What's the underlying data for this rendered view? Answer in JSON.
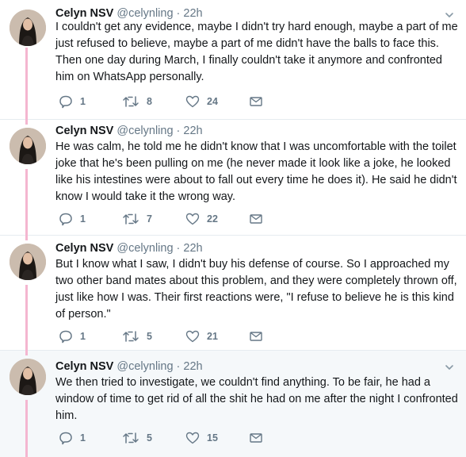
{
  "tweets": [
    {
      "name": "Celyn NSV",
      "handle": "@celynling",
      "separator": "·",
      "time": "22h",
      "text": "I couldn't get any evidence, maybe I didn't try hard enough, maybe a part of me just refused to believe, maybe a part of me didn't have the balls to face this. Then one day during March, I finally couldn't take it anymore and confronted him on WhatsApp personally.",
      "replies": "1",
      "retweets": "8",
      "likes": "24"
    },
    {
      "name": "Celyn NSV",
      "handle": "@celynling",
      "separator": "·",
      "time": "22h",
      "text": "He was calm, he told me he didn't know that I was uncomfortable with the toilet joke that he's been pulling on me (he never made it look like a joke, he looked like his intestines were about to fall out every time he does it). He said he didn't know I would take it the wrong way.",
      "replies": "1",
      "retweets": "7",
      "likes": "22"
    },
    {
      "name": "Celyn NSV",
      "handle": "@celynling",
      "separator": "·",
      "time": "22h",
      "text": "But I know what I saw, I didn't buy his defense of course. So I approached my two other band mates about this problem, and they were completely thrown off, just like how I was. Their first reactions were, \"I refuse to believe he is this kind of person.\"",
      "replies": "1",
      "retweets": "5",
      "likes": "21"
    },
    {
      "name": "Celyn NSV",
      "handle": "@celynling",
      "separator": "·",
      "time": "22h",
      "text": "We then tried to investigate, we couldn't find anything. To be fair, he had a window of time to get rid of all the shit he had on me after the night I confronted him.",
      "replies": "1",
      "retweets": "5",
      "likes": "15"
    }
  ],
  "colors": {
    "thread_line": "#f4b6d0",
    "muted": "#657786",
    "highlight_bg": "#f5f8fa"
  },
  "icons": {
    "reply": "reply-icon",
    "retweet": "retweet-icon",
    "like": "heart-icon",
    "dm": "envelope-icon",
    "menu": "chevron-down-icon"
  }
}
